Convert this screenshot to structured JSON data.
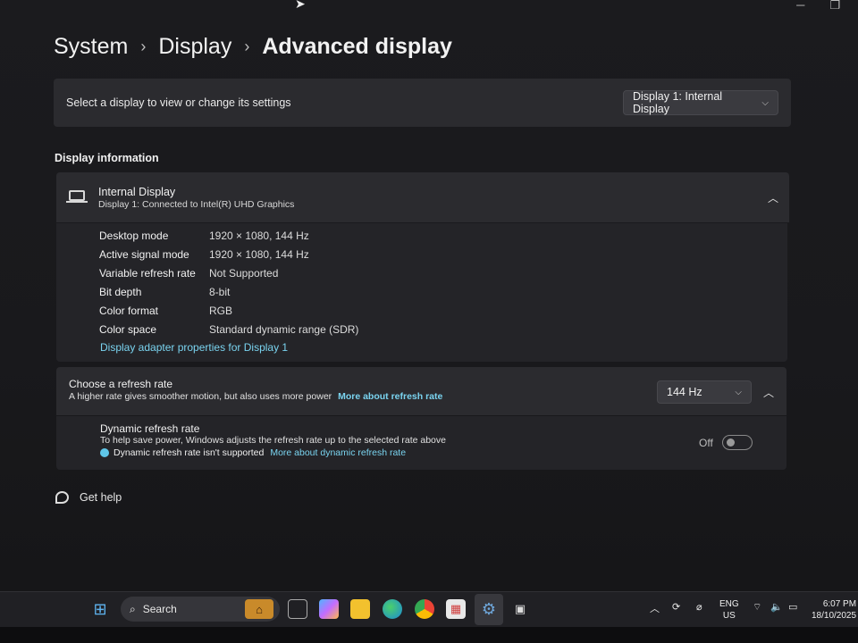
{
  "breadcrumb": {
    "part1": "System",
    "part2": "Display",
    "part3": "Advanced display",
    "sep": "›"
  },
  "display_select": {
    "label": "Select a display to view or change its settings",
    "value": "Display 1: Internal Display"
  },
  "section_title": "Display information",
  "display_info": {
    "name": "Internal Display",
    "connection": "Display 1: Connected to Intel(R) UHD Graphics",
    "rows": [
      {
        "key": "Desktop mode",
        "value": "1920 × 1080, 144 Hz"
      },
      {
        "key": "Active signal mode",
        "value": "1920 × 1080, 144 Hz"
      },
      {
        "key": "Variable refresh rate",
        "value": "Not Supported"
      },
      {
        "key": "Bit depth",
        "value": "8-bit"
      },
      {
        "key": "Color format",
        "value": "RGB"
      },
      {
        "key": "Color space",
        "value": "Standard dynamic range (SDR)"
      }
    ],
    "adapter_link": "Display adapter properties for Display 1"
  },
  "refresh_rate": {
    "title": "Choose a refresh rate",
    "desc": "A higher rate gives smoother motion, but also uses more power",
    "link": "More about refresh rate",
    "value": "144 Hz"
  },
  "dynamic_refresh": {
    "title": "Dynamic refresh rate",
    "desc": "To help save power, Windows adjusts the refresh rate up to the selected rate above",
    "note": "Dynamic refresh rate isn't supported",
    "link": "More about dynamic refresh rate",
    "toggle_label": "Off",
    "enabled": false
  },
  "help": {
    "label": "Get help"
  },
  "taskbar": {
    "search_label": "Search",
    "lang_line1": "ENG",
    "lang_line2": "US",
    "time": "6:07 PM",
    "date": "18/10/2025"
  },
  "colors": {
    "accent_link": "#7ad4f0",
    "card": "#2b2b2f",
    "background": "#1b1b1e"
  }
}
